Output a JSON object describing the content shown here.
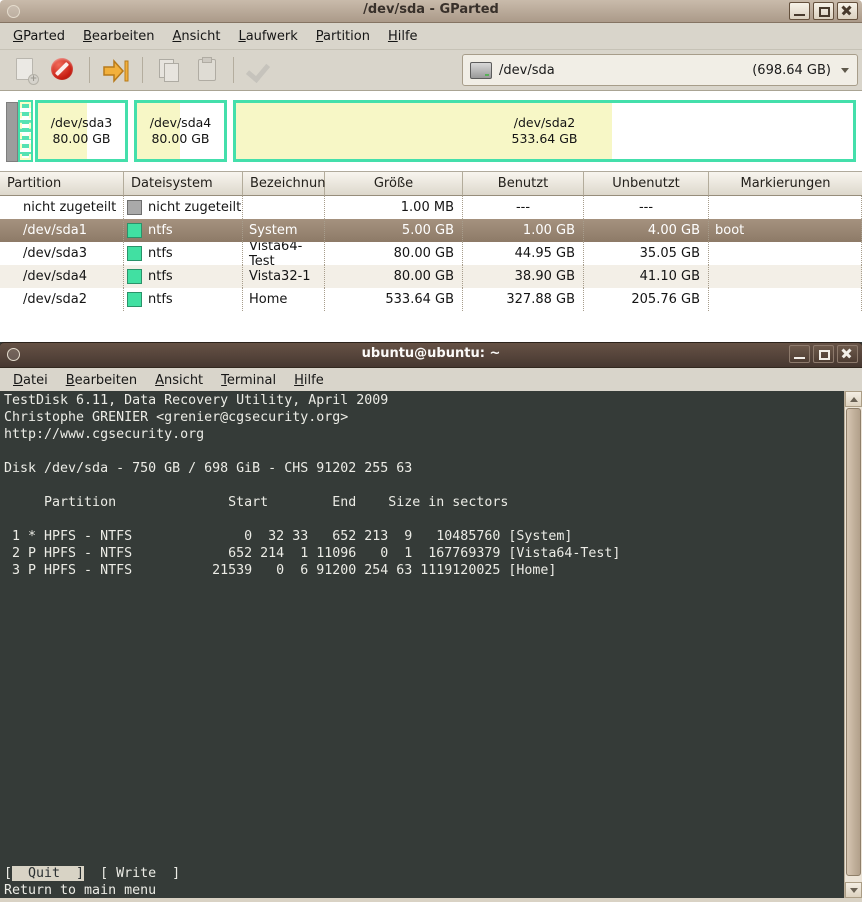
{
  "colors": {
    "accent_teal": "#44DFAB",
    "fill_yellow": "#F7F7C6",
    "selected_row": "#9A8775",
    "ntfs_swatch": "#41E0A2",
    "unallocated_swatch": "#A9A9A9",
    "terminal_bg": "#353B38",
    "terminal_fg": "#ECECE6",
    "titlebar_active": "#554438",
    "titlebar_inactive": "#B5A491",
    "delete_icon_red": "#C81E12",
    "resize_arrow_orange": "#F2B03C"
  },
  "gparted": {
    "title": "/dev/sda - GParted",
    "menu": [
      {
        "label": "GParted"
      },
      {
        "label": "Bearbeiten"
      },
      {
        "label": "Ansicht"
      },
      {
        "label": "Laufwerk"
      },
      {
        "label": "Partition"
      },
      {
        "label": "Hilfe"
      }
    ],
    "device_combo": {
      "device": "/dev/sda",
      "size": "(698.64 GB)"
    },
    "visual": {
      "partitions": [
        {
          "device": "/dev/sda3",
          "size": "80.00 GB",
          "used_pct": 56
        },
        {
          "device": "/dev/sda4",
          "size": "80.00 GB",
          "used_pct": 49
        },
        {
          "device": "/dev/sda2",
          "size": "533.64 GB",
          "used_pct": 61
        }
      ]
    },
    "table": {
      "headers": [
        "Partition",
        "Dateisystem",
        "Bezeichnung",
        "Größe",
        "Benutzt",
        "Unbenutzt",
        "Markierungen"
      ],
      "rows": [
        {
          "partition": "nicht zugeteilt",
          "filesystem": "nicht zugeteilt",
          "label": "",
          "size": "1.00 MB",
          "used": "---",
          "unused": "---",
          "flags": ""
        },
        {
          "partition": "/dev/sda1",
          "filesystem": "ntfs",
          "label": "System",
          "size": "5.00 GB",
          "used": "1.00 GB",
          "unused": "4.00 GB",
          "flags": "boot"
        },
        {
          "partition": "/dev/sda3",
          "filesystem": "ntfs",
          "label": "Vista64-Test",
          "size": "80.00 GB",
          "used": "44.95 GB",
          "unused": "35.05 GB",
          "flags": ""
        },
        {
          "partition": "/dev/sda4",
          "filesystem": "ntfs",
          "label": "Vista32-1",
          "size": "80.00 GB",
          "used": "38.90 GB",
          "unused": "41.10 GB",
          "flags": ""
        },
        {
          "partition": "/dev/sda2",
          "filesystem": "ntfs",
          "label": "Home",
          "size": "533.64 GB",
          "used": "327.88 GB",
          "unused": "205.76 GB",
          "flags": ""
        }
      ]
    }
  },
  "terminal": {
    "title": "ubuntu@ubuntu: ~",
    "menu": [
      {
        "label": "Datei"
      },
      {
        "label": "Bearbeiten"
      },
      {
        "label": "Ansicht"
      },
      {
        "label": "Terminal"
      },
      {
        "label": "Hilfe"
      }
    ],
    "lines": [
      "TestDisk 6.11, Data Recovery Utility, April 2009",
      "Christophe GRENIER <grenier@cgsecurity.org>",
      "http://www.cgsecurity.org",
      "",
      "Disk /dev/sda - 750 GB / 698 GiB - CHS 91202 255 63",
      "",
      "     Partition              Start        End    Size in sectors",
      "",
      " 1 * HPFS - NTFS              0  32 33   652 213  9   10485760 [System]",
      " 2 P HPFS - NTFS            652 214  1 11096   0  1  167769379 [Vista64-Test]",
      " 3 P HPFS - NTFS          21539   0  6 91200 254 63 1119120025 [Home]"
    ],
    "menu_line": {
      "bracket": "[",
      "quit": "  Quit  ]",
      "rest": "  [ Write  ]"
    },
    "status": "Return to main menu"
  }
}
